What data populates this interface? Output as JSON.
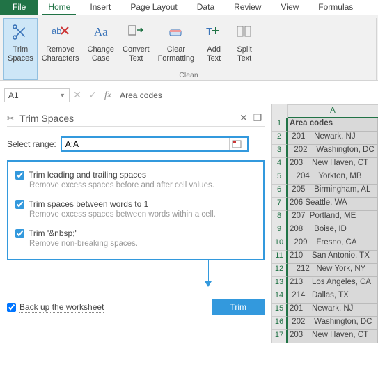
{
  "tabs": {
    "file": "File",
    "home": "Home",
    "insert": "Insert",
    "page": "Page Layout",
    "data": "Data",
    "review": "Review",
    "view": "View",
    "formulas": "Formulas"
  },
  "ribbon": {
    "trim": "Trim\nSpaces",
    "remove": "Remove\nCharacters",
    "chcase": "Change\nCase",
    "convert": "Convert\nText",
    "clear": "Clear\nFormatting",
    "add": "Add\nText",
    "split": "Split\nText",
    "group": "Clean"
  },
  "namebox": "A1",
  "fxvalue": "Area codes",
  "pane": {
    "title": "Trim Spaces"
  },
  "select": {
    "label": "Select range:",
    "value": "A:A"
  },
  "opts": {
    "o1": {
      "t": "Trim leading and trailing spaces",
      "d": "Remove excess spaces before and after cell values."
    },
    "o2": {
      "t": "Trim spaces between words to 1",
      "d": "Remove excess spaces between words within a cell."
    },
    "o3": {
      "t": "Trim '&nbsp;'",
      "d": "Remove non-breaking spaces."
    }
  },
  "backup": "Back up the worksheet",
  "trimbtn": "Trim",
  "colA": "A",
  "rows": [
    "Area codes",
    " 201    Newark, NJ",
    "  202    Washington, DC",
    "203    New Haven, CT",
    "   204    Yorkton, MB",
    " 205    Birmingham, AL",
    "206 Seattle, WA",
    " 207  Portland, ME",
    "208     Boise, ID",
    "  209    Fresno, CA",
    "210    San Antonio, TX",
    "   212   New York, NY",
    "213    Los Angeles, CA",
    " 214   Dallas, TX",
    "201    Newark, NJ",
    " 202    Washington, DC",
    "203    New Haven, CT"
  ]
}
